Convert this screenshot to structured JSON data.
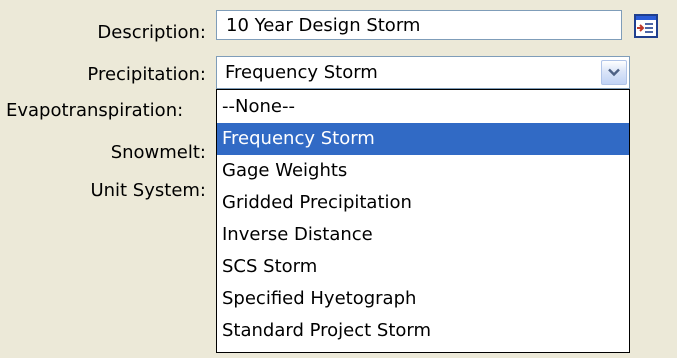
{
  "form": {
    "description_label": "Description:",
    "description_value": "10 Year Design Storm",
    "precipitation_label": "Precipitation:",
    "precipitation_value": "Frequency Storm",
    "evapotranspiration_label": "Evapotranspiration:",
    "snowmelt_label": "Snowmelt:",
    "unit_system_label": "Unit System:"
  },
  "icons": {
    "edit_button": "edit-description-icon",
    "dropdown_arrow": "chevron-down-icon"
  },
  "dropdown": {
    "items": [
      {
        "label": "--None--"
      },
      {
        "label": "Frequency Storm",
        "selected": true
      },
      {
        "label": "Gage Weights"
      },
      {
        "label": "Gridded Precipitation"
      },
      {
        "label": "Inverse Distance"
      },
      {
        "label": "SCS Storm"
      },
      {
        "label": "Specified Hyetograph"
      },
      {
        "label": "Standard Project Storm"
      }
    ]
  },
  "colors": {
    "background": "#ece9d8",
    "selection": "#316ac5",
    "field_border": "#7f9db9"
  }
}
